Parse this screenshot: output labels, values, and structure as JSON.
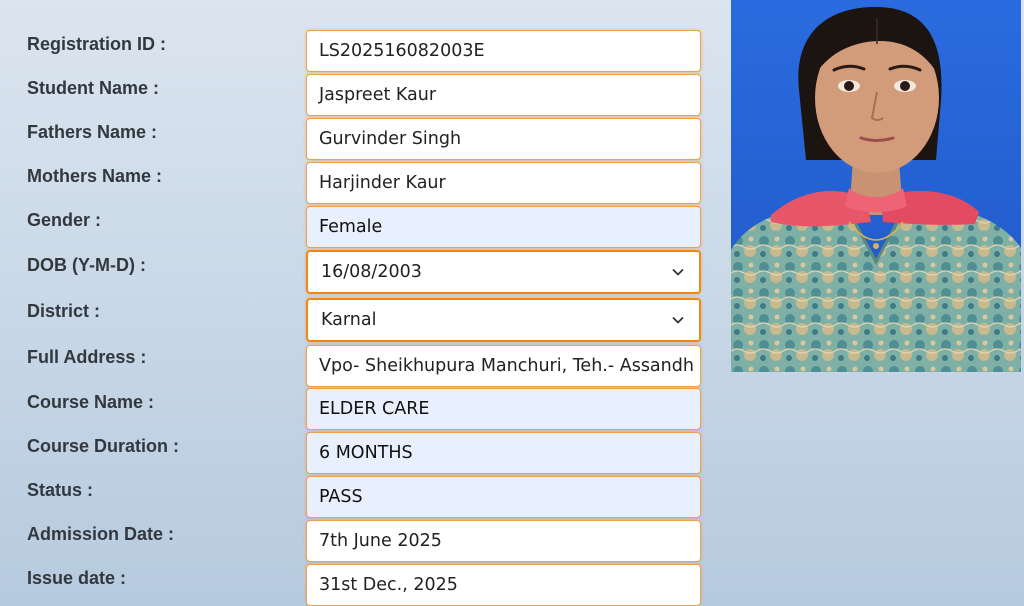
{
  "labels": {
    "registration_id": "Registration ID :",
    "student_name": "Student Name :",
    "fathers_name": "Fathers Name :",
    "mothers_name": "Mothers Name :",
    "gender": "Gender :",
    "dob": "DOB (Y-M-D) :",
    "district": "District :",
    "full_address": "Full Address :",
    "course_name": "Course Name :",
    "course_duration": "Course Duration :",
    "status": "Status :",
    "admission_date": "Admission Date :",
    "issue_date": "Issue date :"
  },
  "values": {
    "registration_id": "LS202516082003E",
    "student_name": "Jaspreet Kaur",
    "fathers_name": "Gurvinder Singh",
    "mothers_name": "Harjinder Kaur",
    "gender": "Female",
    "dob": "16/08/2003",
    "district": "Karnal",
    "full_address": "Vpo- Sheikhupura Manchuri, Teh.- Assandh",
    "course_name": "ELDER CARE",
    "course_duration": "6 MONTHS",
    "status": "PASS",
    "admission_date": "7th June 2025",
    "issue_date": "31st Dec., 2025"
  },
  "photo": {
    "icon": "student-photo",
    "background_color": "#2563d8"
  },
  "colors": {
    "field_border": "#f0a04c",
    "select_border": "#f3870f",
    "readonly_fill": "#e8f0fd"
  }
}
